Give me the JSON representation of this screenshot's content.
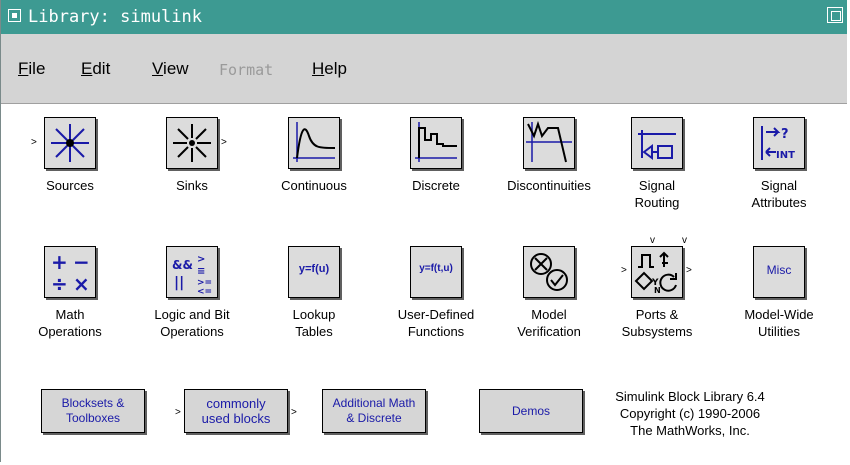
{
  "window": {
    "title": "Library: simulink"
  },
  "menu": [
    {
      "label": "File",
      "mnemonic": "F",
      "rest": "ile"
    },
    {
      "label": "Edit",
      "mnemonic": "E",
      "rest": "dit"
    },
    {
      "label": "View",
      "mnemonic": "V",
      "rest": "iew"
    },
    {
      "label": "Format",
      "disabled": true
    },
    {
      "label": "Help",
      "mnemonic": "H",
      "rest": "elp"
    }
  ],
  "blocks_row1": [
    {
      "label": "Sources",
      "icon": "sources-icon"
    },
    {
      "label": "Sinks",
      "icon": "sinks-icon"
    },
    {
      "label": "Continuous",
      "icon": "continuous-icon"
    },
    {
      "label": "Discrete",
      "icon": "discrete-icon"
    },
    {
      "label": "Discontinuities",
      "icon": "discontinuities-icon"
    },
    {
      "label": "Signal\nRouting",
      "icon": "signal-routing-icon"
    },
    {
      "label": "Signal\nAttributes",
      "icon": "signal-attributes-icon"
    }
  ],
  "blocks_row2": [
    {
      "label": "Math\nOperations",
      "icon": "math-operations-icon"
    },
    {
      "label": "Logic and Bit\nOperations",
      "icon": "logic-bit-icon"
    },
    {
      "label": "Lookup\nTables",
      "icon": "lookup-tables-icon",
      "icon_text": "y=f(u)"
    },
    {
      "label": "User-Defined\nFunctions",
      "icon": "user-defined-icon",
      "icon_text": "y=f(t,u)"
    },
    {
      "label": "Model\nVerification",
      "icon": "model-verification-icon"
    },
    {
      "label": "Ports &\nSubsystems",
      "icon": "ports-subsystems-icon"
    },
    {
      "label": "Model-Wide\nUtilities",
      "icon": "model-wide-icon",
      "icon_text": "Misc"
    }
  ],
  "buttons": [
    {
      "label": "Blocksets &\nToolboxes"
    },
    {
      "label": "commonly\nused blocks"
    },
    {
      "label": "Additional Math\n& Discrete"
    },
    {
      "label": "Demos"
    }
  ],
  "copyright": "Simulink Block Library 6.4\nCopyright (c) 1990-2006\nThe MathWorks, Inc.",
  "colors": {
    "titlebar": "#3d9a92",
    "menubar": "#d4d4d4",
    "block_fill": "#dcdcdc",
    "button_text": "#1a1aa8"
  }
}
